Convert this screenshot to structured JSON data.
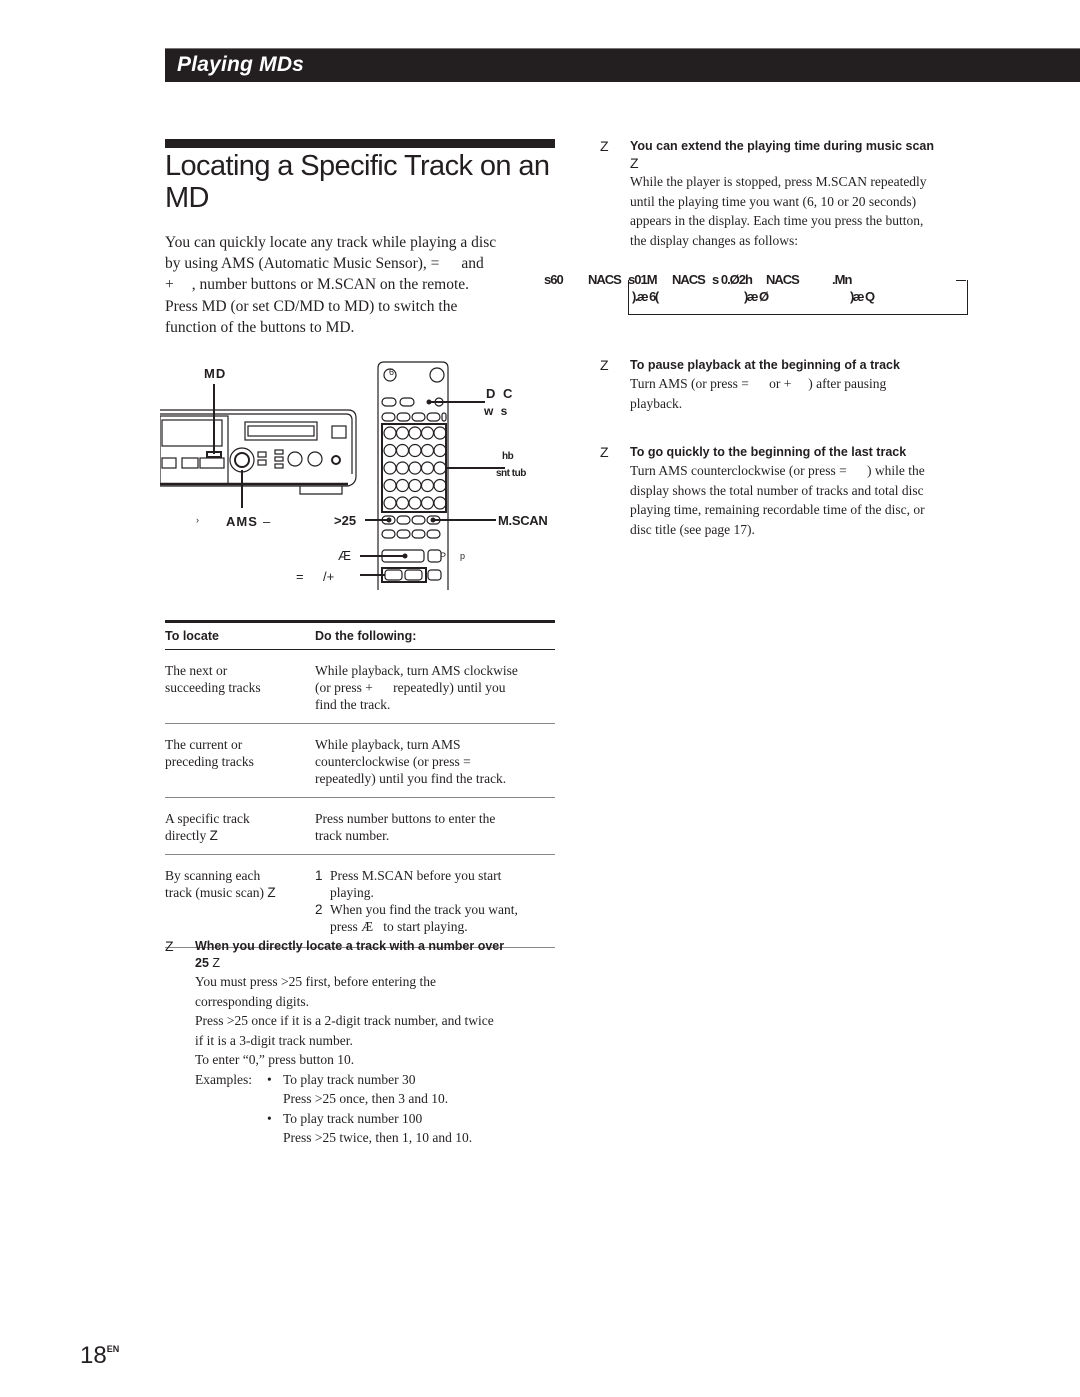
{
  "header": {
    "section_title": "Playing MDs"
  },
  "page": {
    "title": "Locating a Specific Track on an MD",
    "intro": [
      "You can quickly locate any track while playing a disc",
      "by using AMS (Automatic Music Sensor), =",
      "and",
      "+",
      ", number buttons or M.SCAN on the remote.",
      "Press MD (or set CD/MD to MD) to switch the",
      "function of the buttons to MD."
    ],
    "page_number": "18",
    "page_suffix": "EN"
  },
  "illustration": {
    "labels": {
      "md": "MD",
      "ams_prefix": "›",
      "ams": "AMS",
      "ams_suffix": "–",
      "gt25": ">25",
      "play": "Æ",
      "prev": "=",
      "next": "/+",
      "dc_top": "D C",
      "dc_bottom": "w s",
      "num_top": "hb",
      "num_bottom": "snt tub",
      "mscan": "M.SCAN",
      "remote_top_btn": "6",
      "remote_p1": "P",
      "remote_p2": "p"
    }
  },
  "table": {
    "headers": [
      "To locate",
      "Do the following:"
    ],
    "rows": [
      {
        "target": [
          "The next or",
          "succeeding tracks"
        ],
        "action": [
          "While playback, turn AMS clockwise",
          "(or press +      repeatedly) until you",
          "find the track."
        ]
      },
      {
        "target": [
          "The current or",
          "preceding tracks"
        ],
        "action": [
          "While playback, turn AMS",
          "counterclockwise (or press =",
          "repeatedly) until you find the track."
        ]
      },
      {
        "target": [
          "A specific track",
          "directly"
        ],
        "target_mark": "Z",
        "action": [
          "Press number buttons to enter the",
          "track number."
        ]
      },
      {
        "target": [
          "By scanning each",
          "track (music scan)"
        ],
        "target_mark": "Z",
        "steps": [
          {
            "n": "1",
            "text": [
              "Press M.SCAN before you start",
              "playing."
            ]
          },
          {
            "n": "2",
            "text": [
              "When you find the track you want,",
              "press Æ   to start playing."
            ]
          }
        ]
      }
    ]
  },
  "tips": {
    "over25": {
      "marker": "Z",
      "heading": [
        "When you directly locate a track with a number over",
        "25"
      ],
      "heading_mark": "Z",
      "body": [
        "You must press >25 first, before entering the",
        "corresponding digits.",
        "Press >25 once if it is a 2-digit track number, and twice",
        "if it is a 3-digit track number.",
        "To enter “0,” press button 10."
      ],
      "examples_label": "Examples:",
      "examples": [
        {
          "bullet": "•",
          "line1": "To play track number 30",
          "line2": "Press >25 once, then 3 and 10."
        },
        {
          "bullet": "•",
          "line1": "To play track number 100",
          "line2": "Press >25 twice, then 1, 10 and 10."
        }
      ]
    },
    "extend": {
      "marker": "Z",
      "heading": "You can extend the playing time during music scan",
      "heading_mark": "Z",
      "body": [
        "While the player is stopped, press M.SCAN repeatedly",
        "until the playing time you want (6, 10 or 20 seconds)",
        "appears in the display.  Each time you press the button,",
        "the display changes as follows:"
      ],
      "display_sequence": {
        "row1": [
          "s60",
          "NACS",
          "s01M",
          "NACS",
          "s 0.Ø2h",
          "NACS",
          ".Mn"
        ],
        "row2": [
          ").æ  6(",
          ")æ  Ø",
          ")æ  Q"
        ]
      }
    },
    "pause": {
      "marker": "Z",
      "heading": "To pause playback at the beginning of a track",
      "body": [
        "Turn AMS (or press =      or +     ) after pausing",
        "playback."
      ]
    },
    "last": {
      "marker": "Z",
      "heading": "To go quickly to the beginning of the last track",
      "body": [
        "Turn AMS counterclockwise (or press =      ) while the",
        "display shows the total number of tracks and total disc",
        "playing time, remaining recordable time of the disc, or",
        "disc title (see page 17)."
      ]
    }
  }
}
